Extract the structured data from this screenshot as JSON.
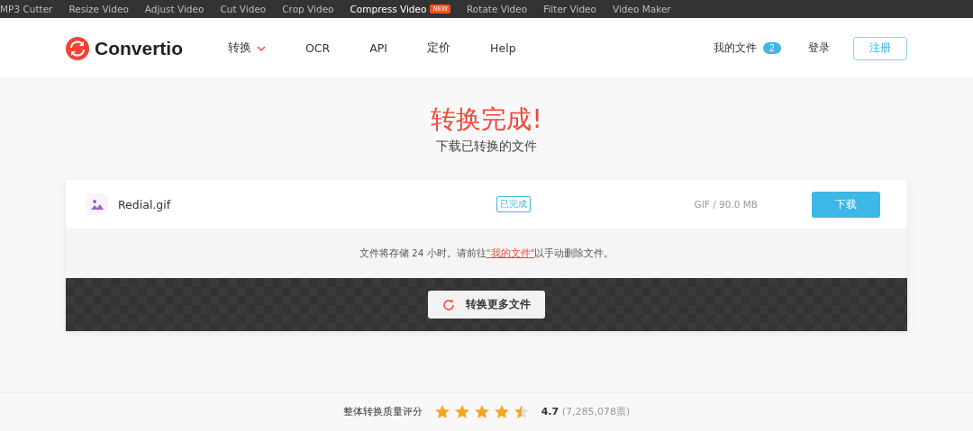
{
  "top_links": [
    {
      "label": "MP3 Cutter",
      "selected": false
    },
    {
      "label": "Resize Video",
      "selected": false
    },
    {
      "label": "Adjust Video",
      "selected": false
    },
    {
      "label": "Cut Video",
      "selected": false
    },
    {
      "label": "Crop Video",
      "selected": false
    },
    {
      "label": "Compress Video",
      "badge": "NEW",
      "selected": true
    },
    {
      "label": "Rotate Video",
      "selected": false
    },
    {
      "label": "Filter Video",
      "selected": false
    },
    {
      "label": "Video Maker",
      "selected": false
    }
  ],
  "brand": "Convertio",
  "nav": [
    {
      "label": "转换",
      "dropdown": true
    },
    {
      "label": "OCR",
      "dropdown": false
    },
    {
      "label": "API",
      "dropdown": false
    },
    {
      "label": "定价",
      "dropdown": false
    },
    {
      "label": "Help",
      "dropdown": false
    }
  ],
  "account": {
    "files_label": "我的文件",
    "files_count": "2",
    "login": "登录",
    "signup": "注册"
  },
  "heading": {
    "title": "转换完成!",
    "subtitle": "下载已转换的文件"
  },
  "file": {
    "name": "Redial.gif",
    "status": "已完成",
    "info": "GIF / 90.0 MB",
    "download": "下载"
  },
  "notice": {
    "before": "文件将存储 24 小时。请前往",
    "link": "\"我的文件\"",
    "after": "以手动删除文件。"
  },
  "more_button": "转换更多文件",
  "rating": {
    "label": "整体转换质量评分",
    "stars": 4.5,
    "score": "4.7",
    "votes": "(7,285,078票)"
  }
}
